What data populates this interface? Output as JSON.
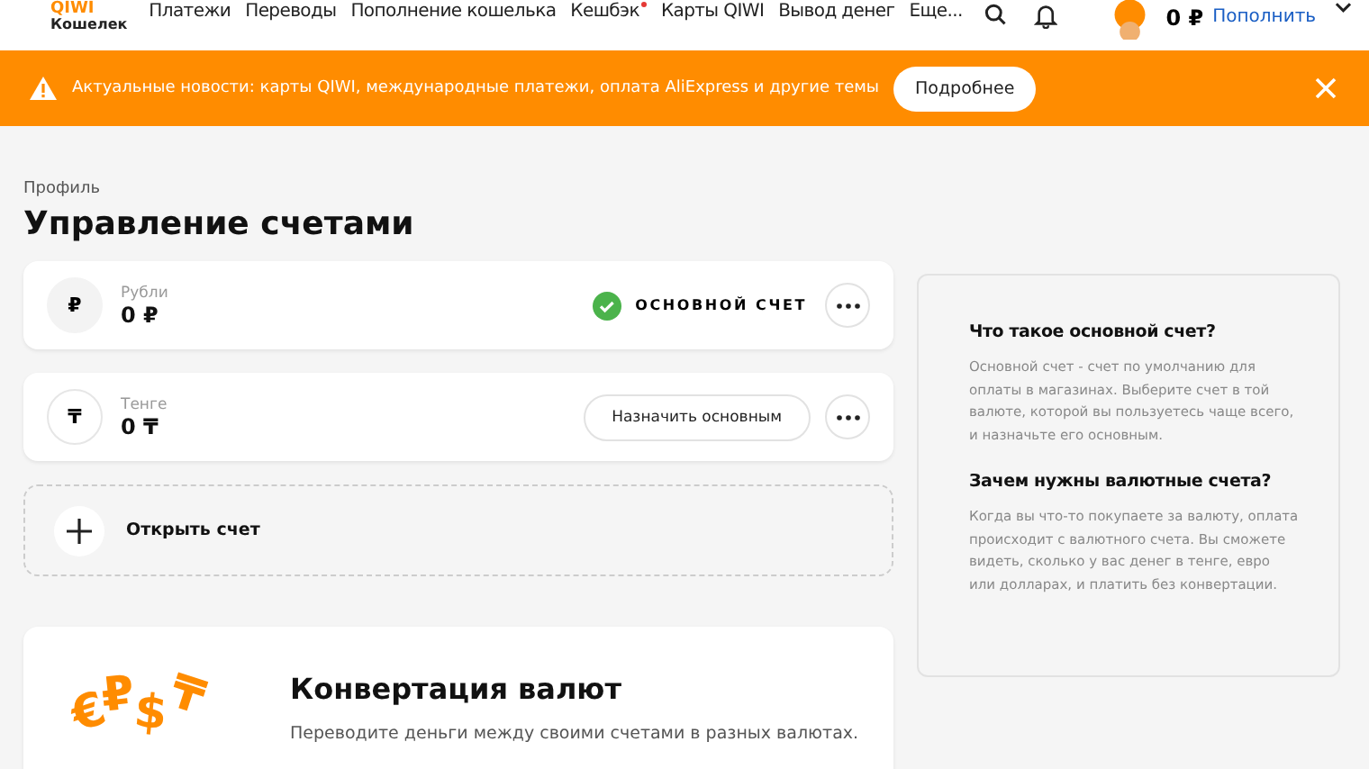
{
  "header": {
    "logo": "QIWI",
    "logo_sub": "Кошелек",
    "nav": [
      {
        "label": "Платежи",
        "badge": false
      },
      {
        "label": "Переводы",
        "badge": false
      },
      {
        "label": "Пополнение кошелька",
        "badge": false
      },
      {
        "label": "Кешбэк",
        "badge": true
      },
      {
        "label": "Карты QIWI",
        "badge": false
      },
      {
        "label": "Вывод денег",
        "badge": false
      },
      {
        "label": "Еще...",
        "badge": false
      }
    ],
    "balance": "0 ₽",
    "topup": "Пополнить"
  },
  "banner": {
    "text": "Актуальные новости: карты QIWI, международные платежи, оплата AliExpress и другие темы",
    "button": "Подробнее"
  },
  "breadcrumb": "Профиль",
  "title": "Управление счетами",
  "accounts": [
    {
      "symbol": "₽",
      "name": "Рубли",
      "balance": "0 ₽",
      "primary": true,
      "status_text": "ОСНОВНОЙ СЧЕТ"
    },
    {
      "symbol": "₸",
      "name": "Тенге",
      "balance": "0 ₸",
      "primary": false,
      "status_text": "Назначить основным"
    }
  ],
  "open_account": "Открыть счет",
  "conversion": {
    "symbols": [
      "€",
      "₽",
      "$",
      "₸"
    ],
    "title": "Конвертация валют",
    "text": "Переводите деньги между своими счетами в разных валютах."
  },
  "info": [
    {
      "title": "Что такое основной счет?",
      "text": "Основной счет - счет по умолчанию для оплаты в магазинах. Выберите счет в той валюте, которой вы пользуетесь чаще всего, и назначьте его основным."
    },
    {
      "title": "Зачем нужны валютные счета?",
      "text": "Когда вы что-то покупаете за валюту, оплата происходит с валютного счета. Вы сможете видеть, сколько у вас денег в тенге, евро или долларах, и платить без конвертации."
    }
  ]
}
